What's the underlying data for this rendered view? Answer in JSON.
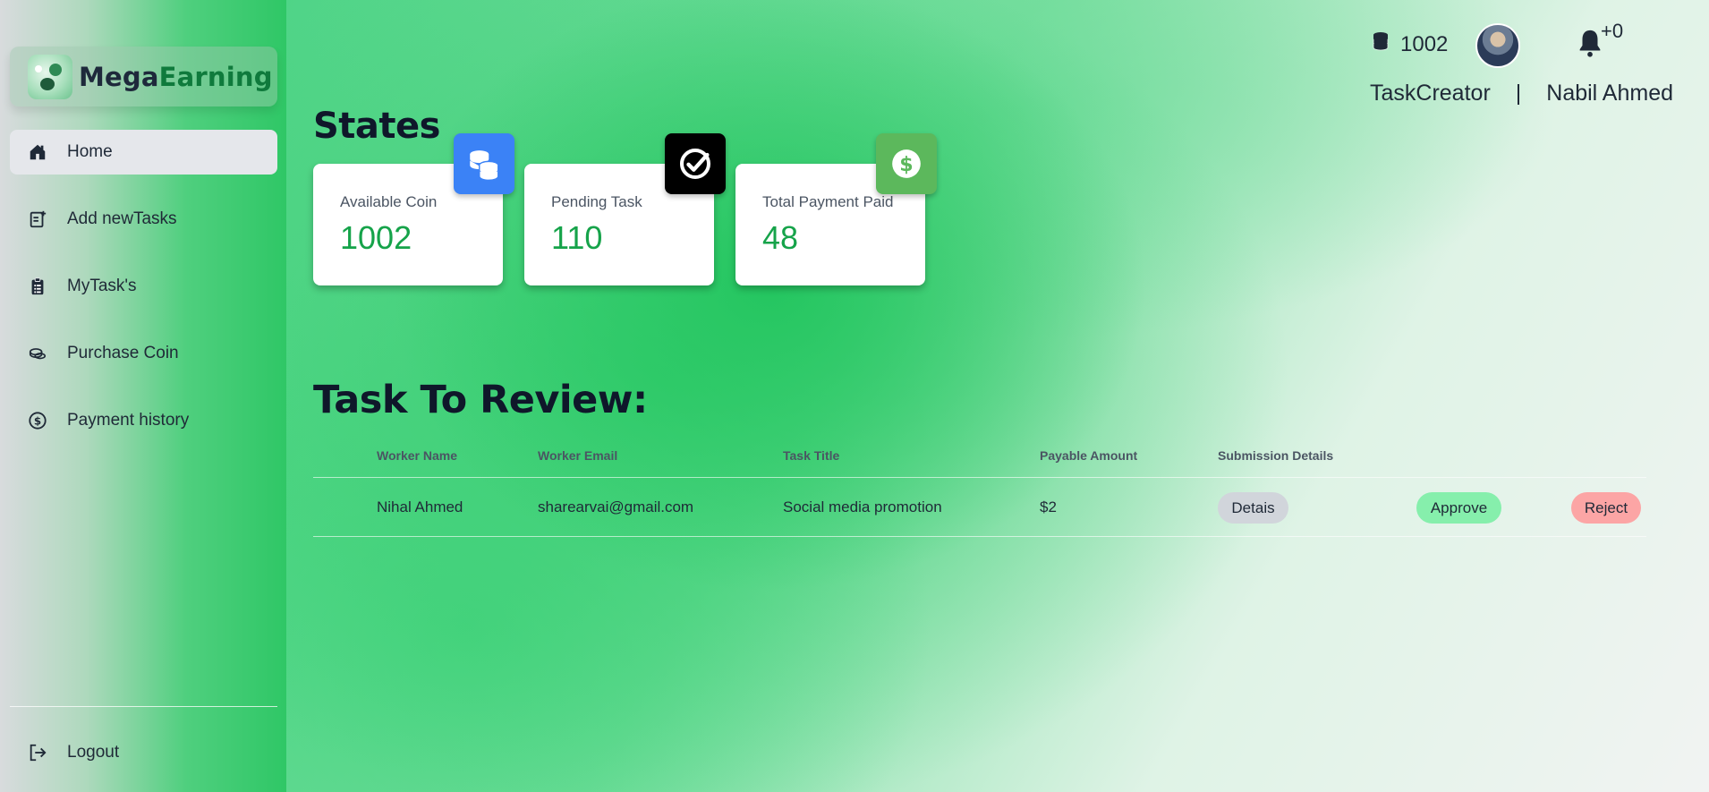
{
  "brand": {
    "name_part1": "Mega",
    "name_part2": "Earning"
  },
  "sidebar": {
    "items": [
      {
        "label": "Home",
        "icon": "home-icon",
        "active": true
      },
      {
        "label": "Add newTasks",
        "icon": "add-task-icon",
        "active": false
      },
      {
        "label": "MyTask's",
        "icon": "clipboard-icon",
        "active": false
      },
      {
        "label": "Purchase Coin",
        "icon": "coins-icon",
        "active": false
      },
      {
        "label": "Payment history",
        "icon": "dollar-circle-icon",
        "active": false
      }
    ],
    "logout_label": "Logout"
  },
  "header": {
    "coin_count": "1002",
    "notification_count": "+0",
    "role": "TaskCreator",
    "separator": "|",
    "user_name": "Nabil Ahmed"
  },
  "states": {
    "title": "States",
    "cards": [
      {
        "label": "Available Coin",
        "value": "1002",
        "icon": "coins-icon",
        "badge_color": "#3b82f6"
      },
      {
        "label": "Pending Task",
        "value": "110",
        "icon": "check-circle-icon",
        "badge_color": "#000000"
      },
      {
        "label": "Total Payment Paid",
        "value": "48",
        "icon": "dollar-circle-icon",
        "badge_color": "#5cb85c"
      }
    ]
  },
  "review": {
    "title": "Task To Review:",
    "columns": [
      "Worker Name",
      "Worker Email",
      "Task Title",
      "Payable Amount",
      "Submission Details"
    ],
    "rows": [
      {
        "worker_name": "Nihal Ahmed",
        "worker_email": "sharearvai@gmail.com",
        "task_title": "Social media promotion",
        "payable_amount": "$2",
        "details_label": "Detais",
        "approve_label": "Approve",
        "reject_label": "Reject"
      }
    ]
  },
  "colors": {
    "accent_green": "#16a34a",
    "sidebar_green": "#2fc766",
    "approve": "#86efac",
    "reject": "#fca5a5",
    "details": "#d1d5db"
  }
}
